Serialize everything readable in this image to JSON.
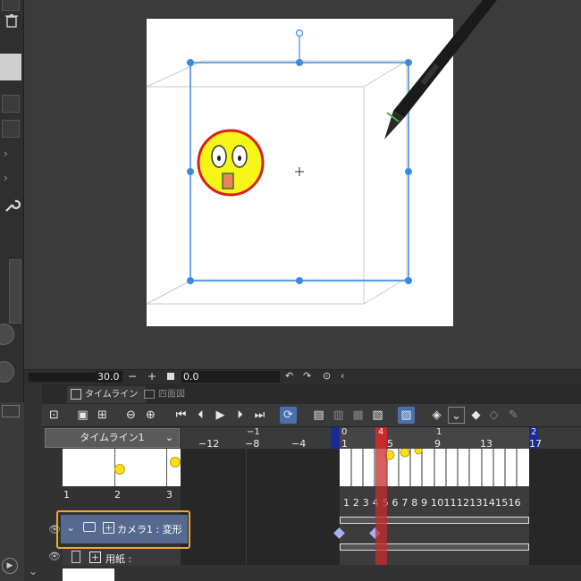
{
  "slider": {
    "brush_size": "30.0",
    "rotation": "0.0",
    "minus": "−",
    "plus": "+"
  },
  "tabs": [
    {
      "label": "タイムライン"
    },
    {
      "label": "四面図"
    }
  ],
  "timeline": {
    "name": "タイムライン1",
    "ruler_top": [
      "−1",
      "1",
      "0",
      "4",
      "1"
    ],
    "ruler_bottom": [
      "−12",
      "−8",
      "−4",
      "1",
      "5",
      "9",
      "13",
      "17"
    ],
    "ruler_end": "2",
    "thumb_numbers": [
      "1",
      "2",
      "3"
    ],
    "frame_numbers": "1 2 3 4 5 6 7 8 9 10111213141516",
    "current_frame": "4"
  },
  "layers": {
    "camera": {
      "label": "カメラ1 : 変形",
      "toggle": "+"
    },
    "paper": {
      "label": "用紙 :",
      "toggle": "+"
    }
  },
  "colors": {
    "accent_blue": "#3a8ae0",
    "playhead_red": "#c62b2b",
    "highlight_orange": "#f0a830",
    "marker_blue": "#1a2a9a",
    "keyframe": "#a8b0f0"
  }
}
